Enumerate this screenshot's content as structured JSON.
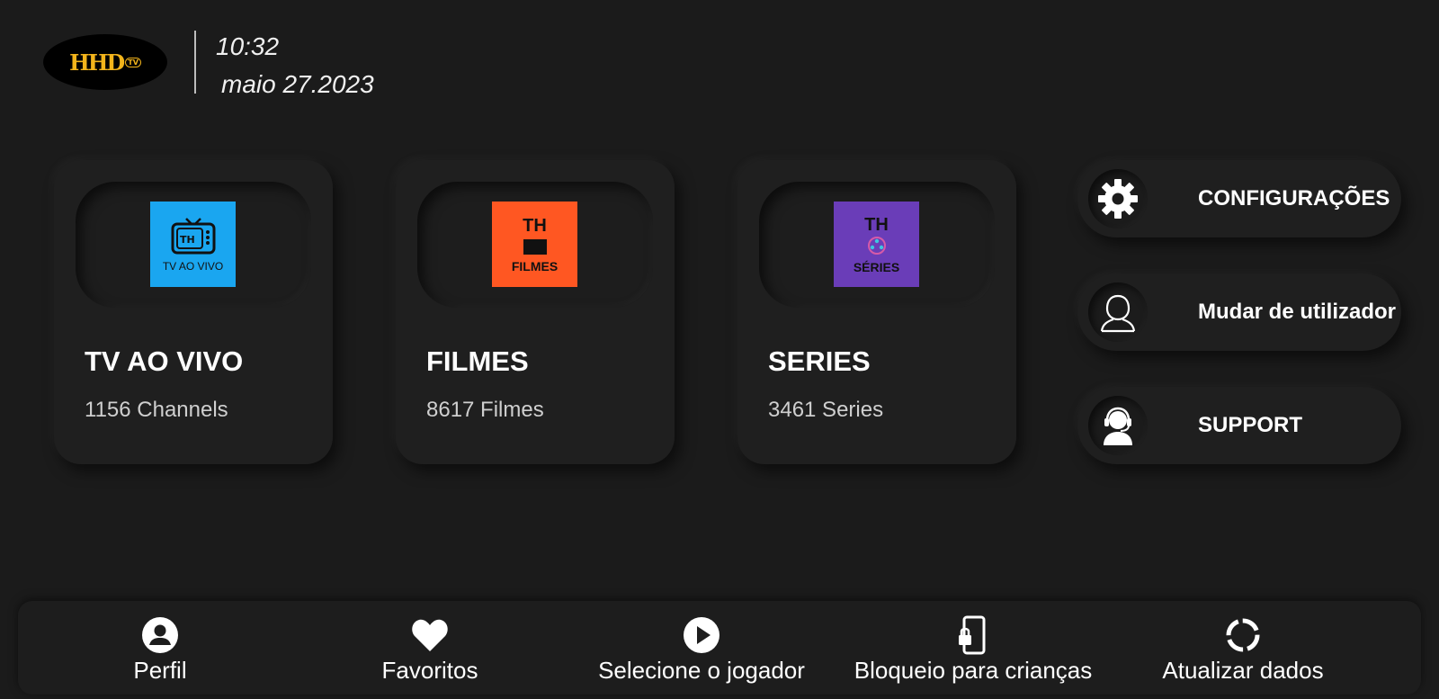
{
  "header": {
    "logo_text": "HHD",
    "logo_sub": "TV",
    "time": "10:32",
    "date": "maio 27.2023"
  },
  "cards": [
    {
      "title": "TV AO VIVO",
      "subtitle": "1156 Channels",
      "tile_top": "TH",
      "tile_label": "TV AO VIVO",
      "tile_color": "#1aa6f0",
      "icon": "tv-icon"
    },
    {
      "title": "FILMES",
      "subtitle": "8617 Filmes",
      "tile_top": "TH",
      "tile_label": "FILMES",
      "tile_color": "#ff5722",
      "icon": "clapperboard-icon"
    },
    {
      "title": "SERIES",
      "subtitle": "3461 Series",
      "tile_top": "TH",
      "tile_label": "SÉRIES",
      "tile_color": "#6a3db8",
      "icon": "film-reel-icon"
    }
  ],
  "side_buttons": [
    {
      "label": "CONFIGURAÇÕES",
      "icon": "gear-icon"
    },
    {
      "label": "Mudar de utilizador",
      "icon": "user-outline-icon"
    },
    {
      "label": "SUPPORT",
      "icon": "headset-icon"
    }
  ],
  "bottom_nav": [
    {
      "label": "Perfil",
      "icon": "profile-icon"
    },
    {
      "label": "Favoritos",
      "icon": "heart-icon"
    },
    {
      "label": "Selecione o jogador",
      "icon": "play-icon"
    },
    {
      "label": "Bloqueio para crianças",
      "icon": "phone-lock-icon"
    },
    {
      "label": "Atualizar dados",
      "icon": "refresh-icon"
    }
  ],
  "colors": {
    "background": "#1b1b1b",
    "card": "#1f1f1f",
    "logo_gold": "#f2b41b"
  }
}
